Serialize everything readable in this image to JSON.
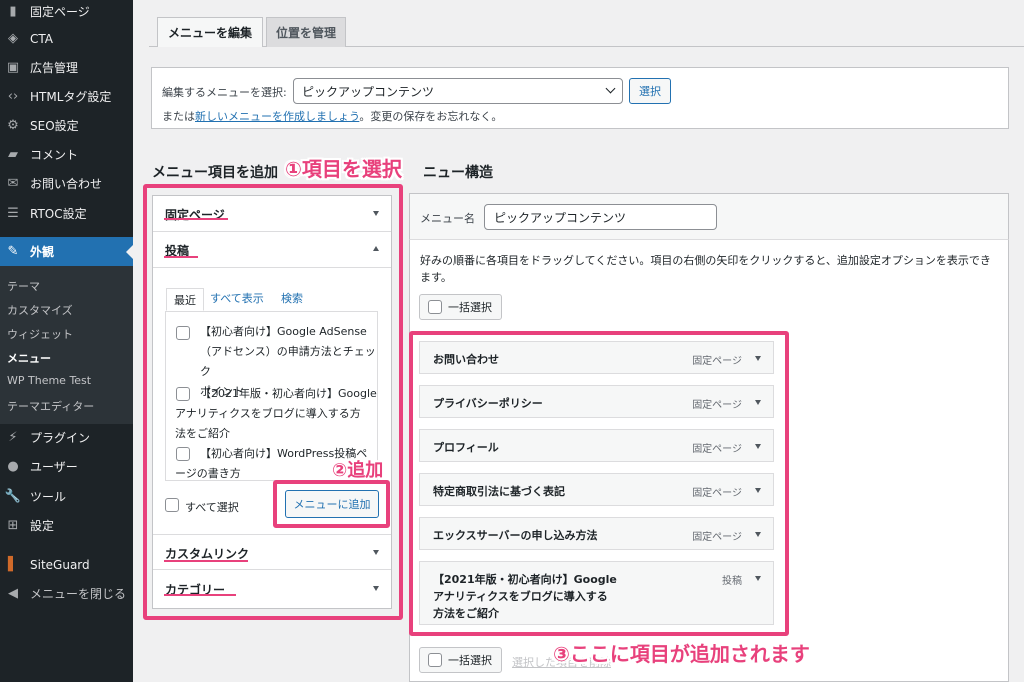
{
  "sidebar": {
    "items": [
      {
        "label": "固定ページ",
        "icon": "page-icon"
      },
      {
        "label": "CTA",
        "icon": "tag-icon"
      },
      {
        "label": "広告管理",
        "icon": "ad-icon"
      },
      {
        "label": "HTMLタグ設定",
        "icon": "code-icon"
      },
      {
        "label": "SEO設定",
        "icon": "gear-icon"
      },
      {
        "label": "コメント",
        "icon": "comment-icon"
      },
      {
        "label": "お問い合わせ",
        "icon": "mail-icon"
      },
      {
        "label": "RTOC設定",
        "icon": "list-icon"
      },
      {
        "label": "外観",
        "icon": "brush-icon"
      },
      {
        "label": "プラグイン",
        "icon": "plugin-icon"
      },
      {
        "label": "ユーザー",
        "icon": "user-icon"
      },
      {
        "label": "ツール",
        "icon": "wrench-icon"
      },
      {
        "label": "設定",
        "icon": "settings-icon"
      },
      {
        "label": "SiteGuard",
        "icon": "shield-icon"
      },
      {
        "label": "メニューを閉じる",
        "icon": "collapse-icon"
      }
    ],
    "submenu": [
      "テーマ",
      "カスタマイズ",
      "ウィジェット",
      "メニュー",
      "WP Theme Test",
      "テーマエディター"
    ]
  },
  "tabs": {
    "edit": "メニューを編集",
    "locations": "位置を管理"
  },
  "select_menu": {
    "label": "編集するメニューを選択:",
    "selected": "ピックアップコンテンツ",
    "button": "選択",
    "or_text": "または",
    "create_link": "新しいメニューを作成しましょう",
    "reminder": "。変更の保存をお忘れなく。"
  },
  "add_items": {
    "title": "メニュー項目を追加",
    "sections": {
      "pages": "固定ページ",
      "posts": "投稿",
      "custom": "カスタムリンク",
      "category": "カテゴリー"
    },
    "post_tabs": [
      "最近",
      "すべて表示",
      "検索"
    ],
    "posts": [
      {
        "line1": "【初心者向け】Google AdSense",
        "line2": "（アドセンス）の申請方法とチェック",
        "line3": "ポイント"
      },
      {
        "line1": "【2021年版・初心者向け】Google",
        "line2": "アナリティクスをブログに導入する方",
        "line3": "法をご紹介"
      },
      {
        "line1": "【初心者向け】WordPress投稿ペ",
        "line2": "ージの書き方"
      }
    ],
    "select_all": "すべて選択",
    "add_button": "メニューに追加"
  },
  "structure": {
    "title_partial": "ニュー構造",
    "name_label": "メニュー名",
    "name_value": "ピックアップコンテンツ",
    "instructions": "好みの順番に各項目をドラッグしてください。項目の右側の矢印をクリックすると、追加設定オプションを表示できます。",
    "bulk_select": "一括選択",
    "remove_selected": "選択した項目を削除",
    "items": [
      {
        "title": "お問い合わせ",
        "type": "固定ページ"
      },
      {
        "title": "プライバシーポリシー",
        "type": "固定ページ"
      },
      {
        "title": "プロフィール",
        "type": "固定ページ"
      },
      {
        "title": "特定商取引法に基づく表記",
        "type": "固定ページ"
      },
      {
        "title": "エックスサーバーの申し込み方法",
        "type": "固定ページ"
      },
      {
        "title1": "【2021年版・初心者向け】Google",
        "title2": "アナリティクスをブログに導入する",
        "title3": "方法をご紹介",
        "type": "投稿"
      }
    ]
  },
  "annotations": {
    "step1": "①項目を選択",
    "step2": "②追加",
    "step3": "③ここに項目が追加されます"
  },
  "colors": {
    "accent": "#2271b1",
    "annotation": "#e8417c",
    "sidebar": "#1d2327"
  }
}
